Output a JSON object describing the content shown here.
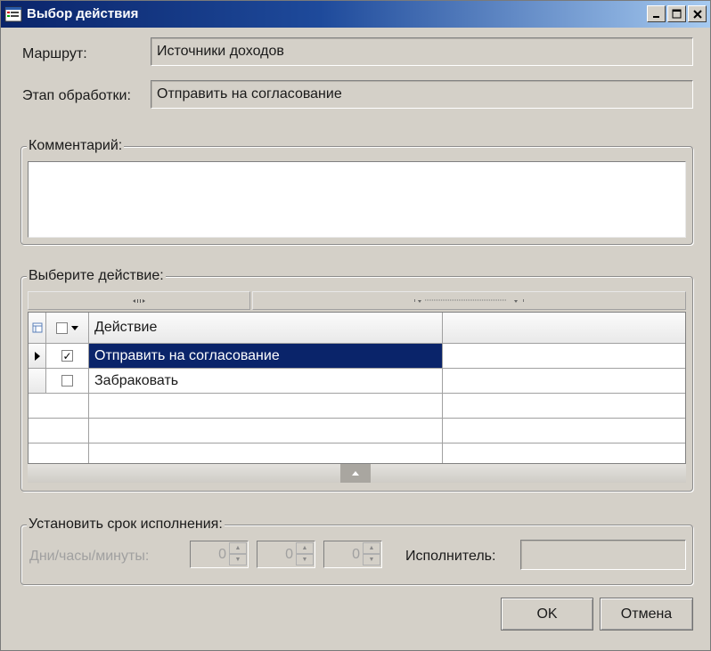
{
  "window": {
    "title": "Выбор действия",
    "controls": [
      "minimize-icon",
      "maximize-icon",
      "close-icon"
    ]
  },
  "route": {
    "label": "Маршрут:",
    "value": "Источники доходов"
  },
  "stage": {
    "label": "Этап обработки:",
    "value": "Отправить на согласование"
  },
  "comment": {
    "title": "Комментарий:",
    "value": ""
  },
  "action_group": {
    "title": "Выберите действие:",
    "grid": {
      "column_header": "Действие",
      "rows": [
        {
          "checked": true,
          "label": "Отправить на согласование",
          "selected": true
        },
        {
          "checked": false,
          "label": "Забраковать",
          "selected": false
        }
      ]
    }
  },
  "deadline": {
    "title": "Установить срок исполнения:",
    "label": "Дни/часы/минуты:",
    "days": "0",
    "hours": "0",
    "minutes": "0",
    "executor_label": "Исполнитель:",
    "executor_value": ""
  },
  "buttons": {
    "ok": "OK",
    "cancel": "Отмена"
  },
  "colors": {
    "title_bar": "#0a246a",
    "selection": "#0a246a",
    "dialog_bg": "#d4d0c8"
  }
}
